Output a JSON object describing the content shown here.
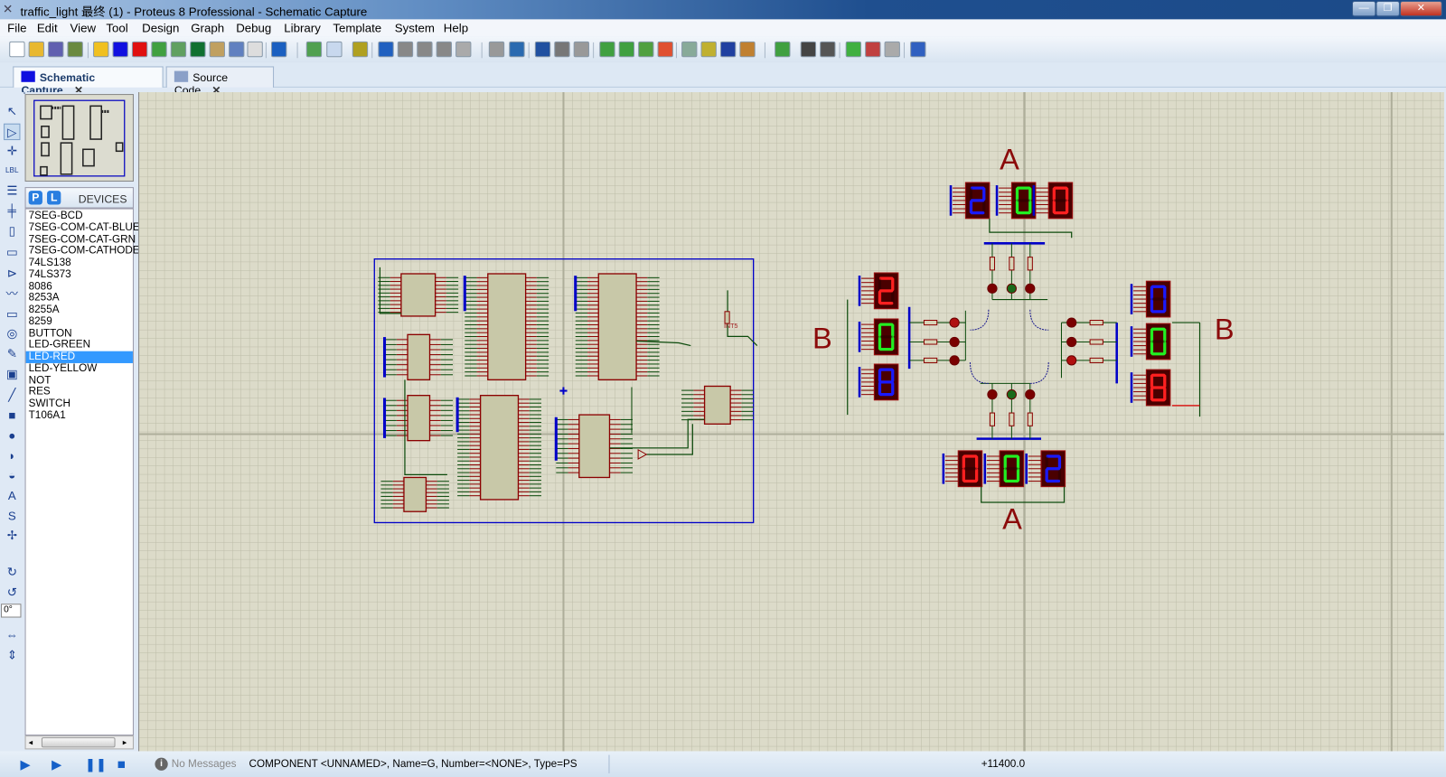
{
  "window": {
    "title": "traffic_light 最终 (1) - Proteus 8 Professional - Schematic Capture",
    "controls": [
      "—",
      "❐",
      "✕"
    ]
  },
  "menu": [
    "File",
    "Edit",
    "View",
    "Tool",
    "Design",
    "Graph",
    "Debug",
    "Library",
    "Template",
    "System",
    "Help"
  ],
  "toolbar": [
    {
      "name": "new-icon",
      "color": "#fff"
    },
    {
      "name": "open-icon",
      "color": "#e8b830"
    },
    {
      "name": "save-icon",
      "color": "#6060b0"
    },
    {
      "name": "import-icon",
      "color": "#6a8a40"
    },
    {
      "name": "home-icon",
      "color": "#f0c020"
    },
    {
      "name": "isis-icon",
      "color": "#1010e0"
    },
    {
      "name": "ares-icon",
      "color": "#e01010"
    },
    {
      "name": "3d-icon",
      "color": "#40a040"
    },
    {
      "name": "gerber-icon",
      "color": "#60a060"
    },
    {
      "name": "design-explorer-icon",
      "color": "#107030"
    },
    {
      "name": "bom-icon",
      "color": "#c0a060"
    },
    {
      "name": "source-code-icon",
      "color": "#6080c0"
    },
    {
      "name": "notes-icon",
      "color": "#ddd"
    },
    {
      "name": "help-icon",
      "color": "#1a5fc0"
    },
    {
      "name": "refresh-icon",
      "color": "#50a050"
    },
    {
      "name": "grid-icon",
      "color": "#c8d8ee"
    },
    {
      "name": "origin-icon",
      "color": "#b0a020"
    },
    {
      "name": "pan-icon",
      "color": "#2060c0"
    },
    {
      "name": "zoom-in-icon",
      "color": "#888"
    },
    {
      "name": "zoom-out-icon",
      "color": "#888"
    },
    {
      "name": "zoom-all-icon",
      "color": "#888"
    },
    {
      "name": "zoom-area-icon",
      "color": "#aaa"
    },
    {
      "name": "undo-icon",
      "color": "#999"
    },
    {
      "name": "redo-icon",
      "color": "#2a6ab0"
    },
    {
      "name": "cut-icon",
      "color": "#2050a0"
    },
    {
      "name": "copy-icon",
      "color": "#777"
    },
    {
      "name": "paste-icon",
      "color": "#999"
    },
    {
      "name": "block-copy-icon",
      "color": "#40a040"
    },
    {
      "name": "block-move-icon",
      "color": "#40a040"
    },
    {
      "name": "block-rotate-icon",
      "color": "#50a040"
    },
    {
      "name": "block-delete-icon",
      "color": "#e05030"
    },
    {
      "name": "pick-device-icon",
      "color": "#8a9"
    },
    {
      "name": "make-device-icon",
      "color": "#c0b030"
    },
    {
      "name": "packaging-tool-icon",
      "color": "#2040a0"
    },
    {
      "name": "decompose-icon",
      "color": "#c08030"
    },
    {
      "name": "wire-autorouter-icon",
      "color": "#40a040"
    },
    {
      "name": "search-icon",
      "color": "#444"
    },
    {
      "name": "property-tool-icon",
      "color": "#555"
    },
    {
      "name": "new-sheet-icon",
      "color": "#40b040"
    },
    {
      "name": "remove-sheet-icon",
      "color": "#c04040"
    },
    {
      "name": "exit-to-parent-icon",
      "color": "#aaa"
    },
    {
      "name": "electrical-rule-check-icon",
      "color": "#3060c0"
    }
  ],
  "tabs": [
    {
      "label": "Schematic Capture",
      "active": true,
      "close": "✕"
    },
    {
      "label": "Source Code",
      "active": false,
      "close": "✕"
    }
  ],
  "left_tools": [
    "selection-mode-icon",
    "component-mode-icon",
    "junction-dot-icon",
    "wire-label-icon",
    "text-script-icon",
    "buses-icon",
    "subcircuit-icon",
    "terminals-icon",
    "device-pins-icon",
    "graph-icon",
    "tape-recorder-icon",
    "generator-icon",
    "voltage-probe-icon",
    "virtual-instruments-icon",
    "line-icon",
    "box-icon",
    "circle-icon",
    "arc-icon",
    "path-icon",
    "text-icon",
    "symbol-icon",
    "marker-icon",
    "rotate-cw-icon",
    "rotate-ccw-icon",
    "flip-horizontal-icon",
    "flip-vertical-icon"
  ],
  "left_tool_glyphs": [
    "↖",
    "▷",
    "✛",
    "LBL",
    "☰",
    "╪",
    "▯",
    "▭",
    "⊳",
    "〰",
    "▭",
    "◎",
    "✎",
    "▣",
    "╱",
    "■",
    "●",
    "◗",
    "◒",
    "A",
    "S",
    "✢",
    "↻",
    "↺",
    "⇔",
    "⇕"
  ],
  "rotation": "0°",
  "devices": {
    "p_label": "P",
    "l_label": "L",
    "header": "DEVICES",
    "selected": "LED-RED",
    "items": [
      "7SEG-BCD",
      "7SEG-COM-CAT-BLUE",
      "7SEG-COM-CAT-GRN",
      "7SEG-COM-CATHODE",
      "74LS138",
      "74LS373",
      "8086",
      "8253A",
      "8255A",
      "8259",
      "BUTTON",
      "LED-GREEN",
      "LED-RED",
      "LED-YELLOW",
      "NOT",
      "RES",
      "SWITCH",
      "T106A1"
    ]
  },
  "schematic": {
    "labels": {
      "top": "A",
      "bottom": "A",
      "left": "B",
      "right": "B",
      "button": "INT5"
    },
    "displays": {
      "top": [
        {
          "digit": "2",
          "color": "#1a1aff"
        },
        {
          "digit": "0",
          "color": "#22ee22"
        },
        {
          "digit": "0",
          "color": "#ff2020"
        }
      ],
      "left": [
        {
          "digit": "2",
          "color": "#ff2020"
        },
        {
          "digit": "0",
          "color": "#22ee22"
        },
        {
          "digit": "8",
          "color": "#1a1aff"
        }
      ],
      "right": [
        {
          "digit": "0",
          "color": "#1a1aff"
        },
        {
          "digit": "0",
          "color": "#22ee22"
        },
        {
          "digit": "8",
          "color": "#ff2020"
        }
      ],
      "bottom": [
        {
          "digit": "0",
          "color": "#ff2020"
        },
        {
          "digit": "0",
          "color": "#22ee22"
        },
        {
          "digit": "2",
          "color": "#1a1aff"
        }
      ]
    },
    "colors": {
      "wire": "#0b4a0b",
      "pin": "#8b0000",
      "bus": "#0000c8",
      "body": "#c8c8a8",
      "grid_bg": "#dcdbc9"
    }
  },
  "status": {
    "messages": "No Messages",
    "info": "COMPONENT <UNNAMED>, Name=G, Number=<NONE>, Type=PS",
    "coord": "+11400.0"
  },
  "sim_controls": [
    "play-icon",
    "step-icon",
    "pause-icon",
    "stop-icon"
  ]
}
